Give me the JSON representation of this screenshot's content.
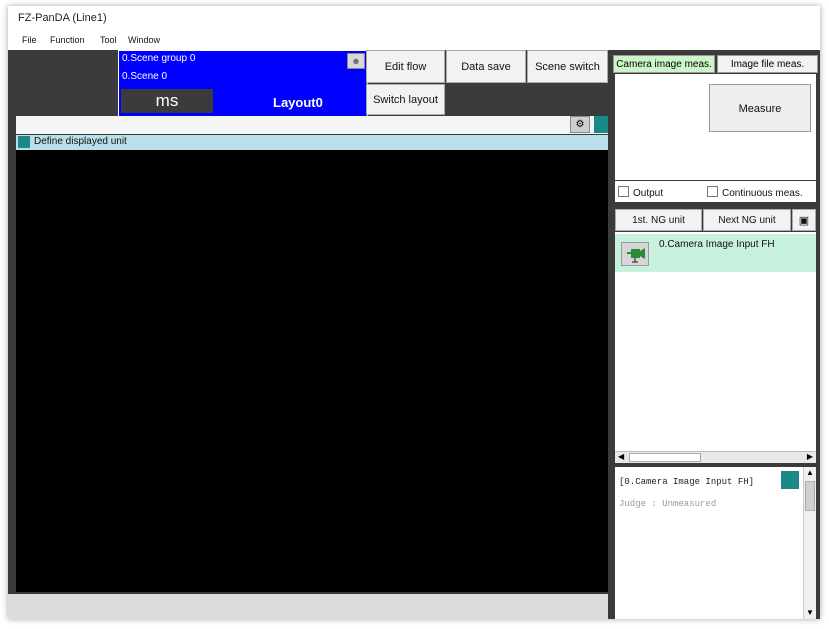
{
  "window": {
    "title": "FZ-PanDA (Line1)"
  },
  "menu": [
    "File",
    "Function",
    "Tool",
    "Window"
  ],
  "info": {
    "scene_group": "0.Scene group 0",
    "scene": "0.Scene 0",
    "time_unit": "ms",
    "layout": "Layout0"
  },
  "toolbar": {
    "edit_flow": "Edit flow",
    "data_save": "Data save",
    "scene_switch": "Scene switch",
    "switch_layout": "Switch layout"
  },
  "viewer": {
    "unit_header": "Define displayed unit"
  },
  "right_panel": {
    "tabs": [
      "Camera image meas.",
      "Image file meas."
    ],
    "measure": "Measure",
    "output_label": "Output",
    "continuous_label": "Continuous meas.",
    "first_ng": "1st. NG unit",
    "next_ng": "Next NG unit",
    "flow_items": [
      "0.Camera Image Input FH"
    ],
    "detail_title": "[0.Camera Image Input FH]",
    "detail_judge": "Judge : Unmeasured"
  },
  "colors": {
    "scene_info_bg": "#0000ff",
    "accent_teal": "#1a8a88",
    "flow_item_bg": "#c7f0dd",
    "unit_header_bg": "#b9e0ea",
    "active_tab_bg": "#ccf5c8"
  }
}
